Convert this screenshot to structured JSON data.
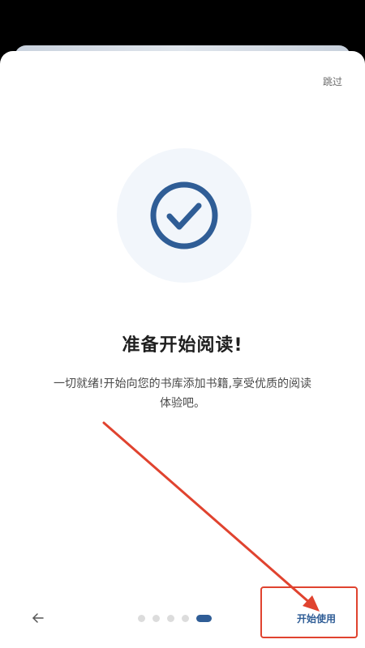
{
  "header": {
    "skip_label": "跳过"
  },
  "hero": {
    "icon": "check-circle-icon",
    "circle_color": "#f2f6fb",
    "icon_color": "#2f5d96"
  },
  "content": {
    "title": "准备开始阅读!",
    "description_line1": "一切就绪!开始向您的书库添加书籍,享受优质的阅读",
    "description_line2": "体验吧。"
  },
  "footer": {
    "back_icon": "arrow-left-icon",
    "page_count": 5,
    "active_page": 5,
    "start_label": "开始使用"
  },
  "colors": {
    "accent": "#2f5d96",
    "annotation": "#e0432f"
  }
}
